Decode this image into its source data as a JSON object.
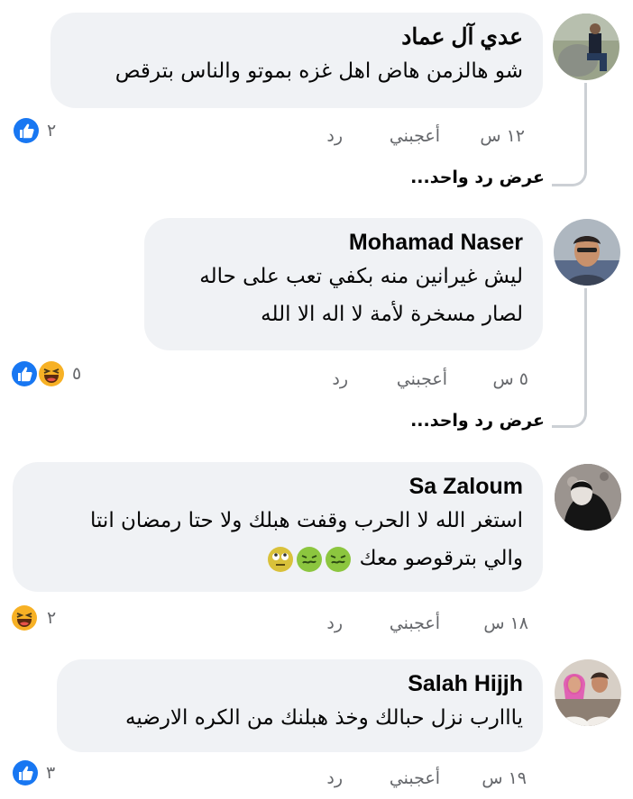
{
  "comments": [
    {
      "author": "عدي آل عماد",
      "text": [
        "شو هالزمن هاض اهل غزه بموتو والناس بترقص"
      ],
      "time": "١٢ س",
      "like_label": "أعجبني",
      "reply_label": "رد",
      "reaction_count": "٢",
      "reactions": [
        "like"
      ],
      "view_replies": "عرض رد واحد..."
    },
    {
      "author": "Mohamad Naser",
      "text": [
        "ليش غيرانين منه بكفي تعب على حاله",
        "لصار مسخرة لأمة لا اله الا الله"
      ],
      "time": "٥ س",
      "like_label": "أعجبني",
      "reply_label": "رد",
      "reaction_count": "٥",
      "reactions": [
        "like",
        "haha"
      ],
      "view_replies": "عرض رد واحد..."
    },
    {
      "author": "Sa Zaloum",
      "text": [
        "استغر الله لا الحرب وقفت هبلك ولا حتا رمضان انتا",
        "والي بترقوصو معك"
      ],
      "text_emojis": [
        "nauseated-face",
        "nauseated-face",
        "face-with-rolling-eyes"
      ],
      "time": "١٨ س",
      "like_label": "أعجبني",
      "reply_label": "رد",
      "reaction_count": "٢",
      "reactions": [
        "haha"
      ]
    },
    {
      "author": "Salah Hijjh",
      "text": [
        "يااارب نزل حبالك وخذ هبلنك من الكره الارضيه"
      ],
      "time": "١٩ س",
      "like_label": "أعجبني",
      "reply_label": "رد",
      "reaction_count": "٣",
      "reactions": [
        "like"
      ]
    }
  ],
  "colors": {
    "bubble": "#f0f2f5",
    "meta_text": "#65676b",
    "like_blue": "#1877f2",
    "haha_yellow": "#f7b125",
    "thread_line": "#ccd0d5"
  }
}
